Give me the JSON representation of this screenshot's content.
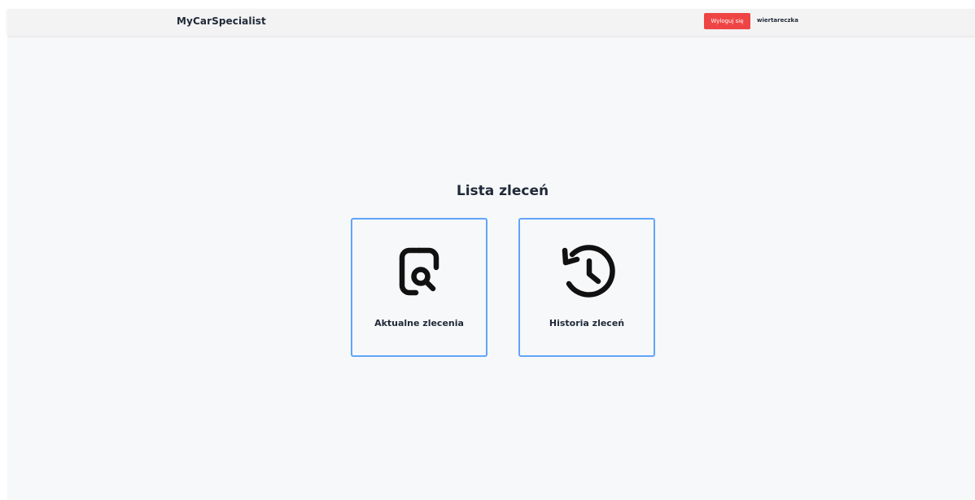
{
  "navbar": {
    "brand": "MyCarSpecialist",
    "logout_label": "Wyloguj się",
    "username": "wiertareczka",
    "logout_color": "#ef4444"
  },
  "main": {
    "title": "Lista zleceń",
    "cards": [
      {
        "label": "Aktualne zlecenia",
        "icon": "search-document-icon"
      },
      {
        "label": "Historia zleceń",
        "icon": "history-clock-icon"
      }
    ],
    "card_border_color": "#60a5fa"
  }
}
